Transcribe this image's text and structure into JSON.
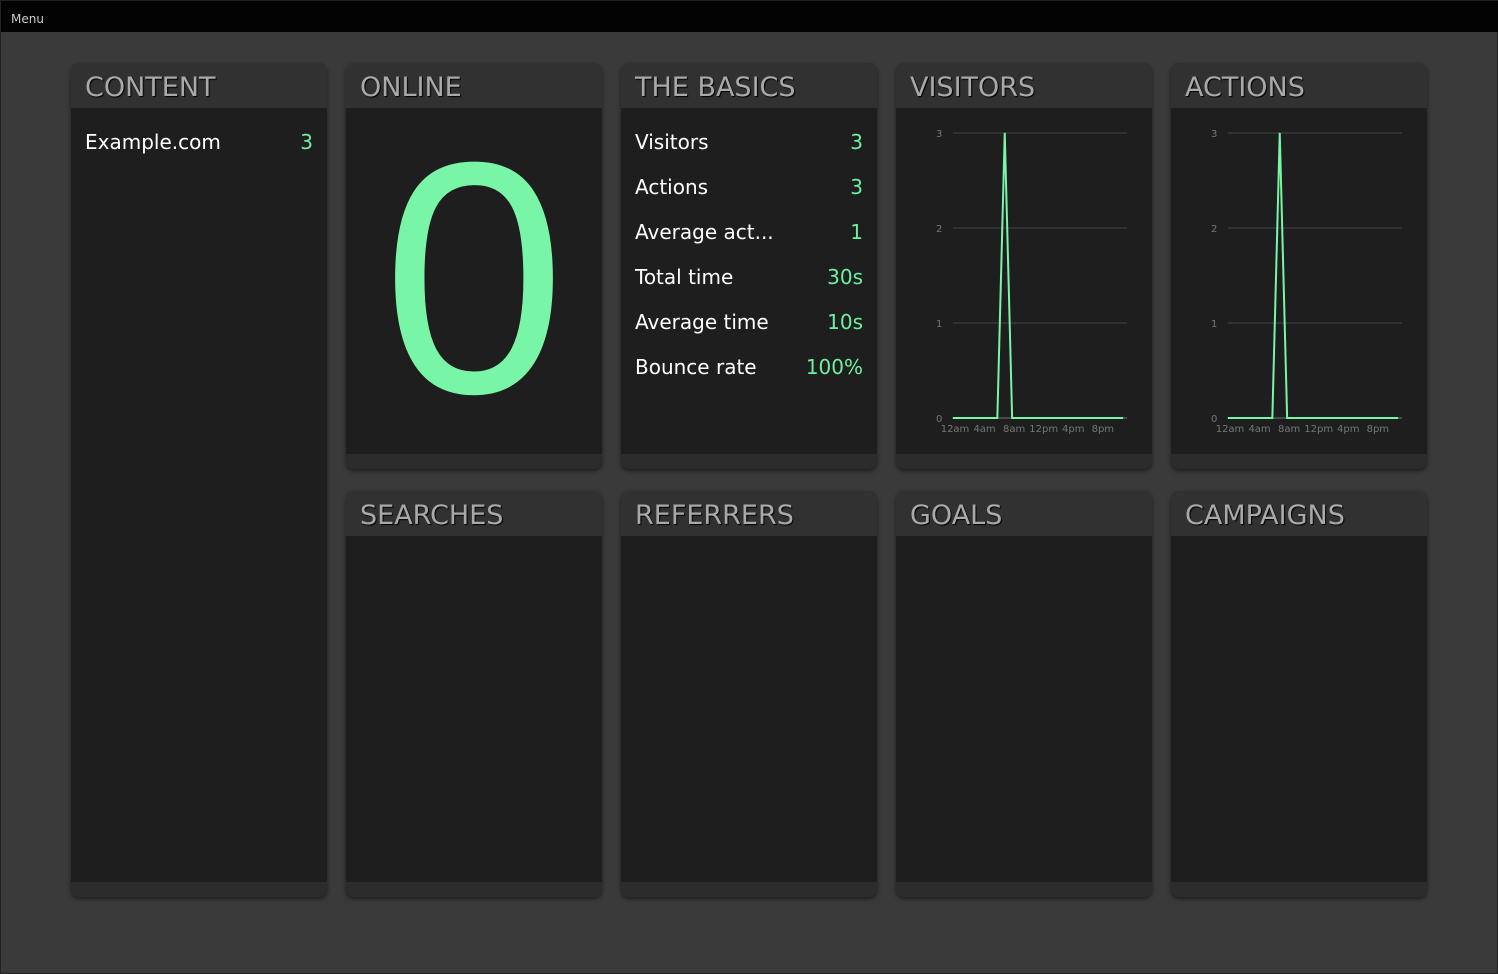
{
  "menu_label": "Menu",
  "accent": "#79f5a8",
  "panels": {
    "content": {
      "title": "CONTENT",
      "items": [
        {
          "label": "Example.com",
          "value": "3"
        }
      ]
    },
    "online": {
      "title": "ONLINE",
      "value": "0"
    },
    "basics": {
      "title": "THE BASICS",
      "rows": [
        {
          "label": "Visitors",
          "value": "3"
        },
        {
          "label": "Actions",
          "value": "3"
        },
        {
          "label": "Average act...",
          "value": "1"
        },
        {
          "label": "Total time",
          "value": "30s"
        },
        {
          "label": "Average time",
          "value": "10s"
        },
        {
          "label": "Bounce rate",
          "value": "100%"
        }
      ]
    },
    "visitors": {
      "title": "VISITORS"
    },
    "actions": {
      "title": "ACTIONS"
    },
    "searches": {
      "title": "SEARCHES"
    },
    "referrers": {
      "title": "REFERRERS"
    },
    "goals": {
      "title": "GOALS"
    },
    "campaigns": {
      "title": "CAMPAIGNS"
    }
  },
  "chart_data": [
    {
      "type": "line",
      "title": "VISITORS",
      "x": [
        0,
        1,
        2,
        3,
        4,
        5,
        6,
        7,
        8,
        9,
        10,
        11,
        12,
        13,
        14,
        15,
        16,
        17,
        18,
        19,
        20,
        21,
        22,
        23
      ],
      "values": [
        0,
        0,
        0,
        0,
        0,
        0,
        0,
        3,
        0,
        0,
        0,
        0,
        0,
        0,
        0,
        0,
        0,
        0,
        0,
        0,
        0,
        0,
        0,
        0
      ],
      "ylim": [
        0,
        3
      ],
      "yticks": [
        "0",
        "1",
        "2",
        "3"
      ],
      "xticks": [
        "12am",
        "4am",
        "8am",
        "12pm",
        "4pm",
        "8pm"
      ],
      "grid": true
    },
    {
      "type": "line",
      "title": "ACTIONS",
      "x": [
        0,
        1,
        2,
        3,
        4,
        5,
        6,
        7,
        8,
        9,
        10,
        11,
        12,
        13,
        14,
        15,
        16,
        17,
        18,
        19,
        20,
        21,
        22,
        23
      ],
      "values": [
        0,
        0,
        0,
        0,
        0,
        0,
        0,
        3,
        0,
        0,
        0,
        0,
        0,
        0,
        0,
        0,
        0,
        0,
        0,
        0,
        0,
        0,
        0,
        0
      ],
      "ylim": [
        0,
        3
      ],
      "yticks": [
        "0",
        "1",
        "2",
        "3"
      ],
      "xticks": [
        "12am",
        "4am",
        "8am",
        "12pm",
        "4pm",
        "8pm"
      ],
      "grid": true
    }
  ]
}
